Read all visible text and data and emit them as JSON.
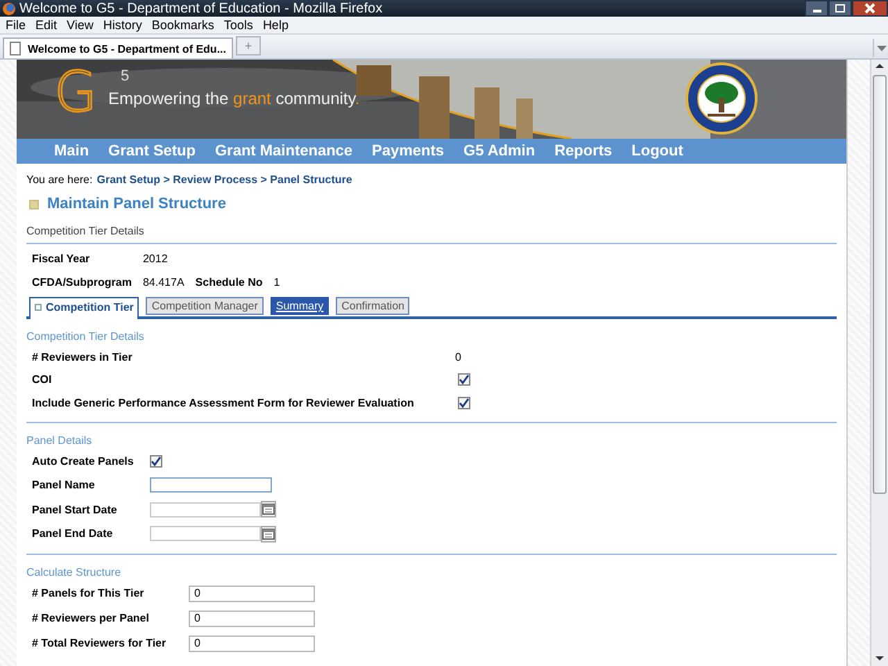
{
  "window": {
    "title": "Welcome to G5 - Department of Education - Mozilla Firefox"
  },
  "menu": [
    "File",
    "Edit",
    "View",
    "History",
    "Bookmarks",
    "Tools",
    "Help"
  ],
  "browser_tabs": [
    {
      "label": "Welcome to G5 - Department of Edu...",
      "selected": true
    }
  ],
  "new_tab_button": "+",
  "banner": {
    "logo": "G",
    "logo_superscript": "5",
    "tagline": [
      {
        "text": "Empowering the ",
        "accent": false
      },
      {
        "text": "grant",
        "accent": true
      },
      {
        "text": " community",
        "accent": false
      },
      {
        "text": ".",
        "accent": true
      }
    ]
  },
  "nav": [
    "Main",
    "Grant Setup",
    "Grant Maintenance",
    "Payments",
    "G5 Admin",
    "Reports",
    "Logout"
  ],
  "breadcrumb": {
    "label": "You are here:",
    "path": "Grant Setup > Review Process > Panel Structure"
  },
  "page_title": "Maintain Panel Structure",
  "section_title": "Competition Tier Details",
  "info_rows": [
    [
      {
        "label": "Fiscal Year",
        "value": "2012"
      }
    ],
    [
      {
        "label": "CFDA/Subprogram",
        "value": "84.417A"
      },
      {
        "label": "Schedule No",
        "value": "1"
      }
    ]
  ],
  "tabs": [
    {
      "label": "Competition Tier",
      "selected": true,
      "kind": "tab"
    },
    {
      "label": "Competition Manager",
      "selected": false,
      "kind": "tab"
    },
    {
      "label": "Summary",
      "selected": false,
      "kind": "link"
    },
    {
      "label": "Confirmation",
      "selected": false,
      "kind": "tab"
    }
  ],
  "sections": [
    {
      "title": "Competition Tier Details",
      "fields": [
        {
          "kind": "text",
          "label": "# Reviewers in Tier",
          "value": "0"
        },
        {
          "kind": "checkbox",
          "label": "COI",
          "checked": true
        },
        {
          "kind": "checkbox",
          "label": "Include Generic Performance Assessment Form for Reviewer Evaluation",
          "checked": true
        }
      ]
    },
    {
      "title": "Panel Details",
      "fields": [
        {
          "kind": "checkbox",
          "label": "Auto Create Panels",
          "checked": true
        },
        {
          "kind": "input",
          "label": "Panel Name",
          "focused": true
        },
        {
          "kind": "date",
          "label": "Panel Start Date"
        },
        {
          "kind": "date",
          "label": "Panel End Date"
        }
      ]
    },
    {
      "title": "Calculate Structure",
      "fields": [
        {
          "kind": "input",
          "label": "# Panels for This Tier",
          "value": "0",
          "focused": false
        },
        {
          "kind": "input",
          "label": "# Reviewers per Panel",
          "value": "0",
          "focused": false
        },
        {
          "kind": "input",
          "label": "# Total Reviewers for Tier",
          "value": "0",
          "focused": false
        }
      ]
    }
  ]
}
